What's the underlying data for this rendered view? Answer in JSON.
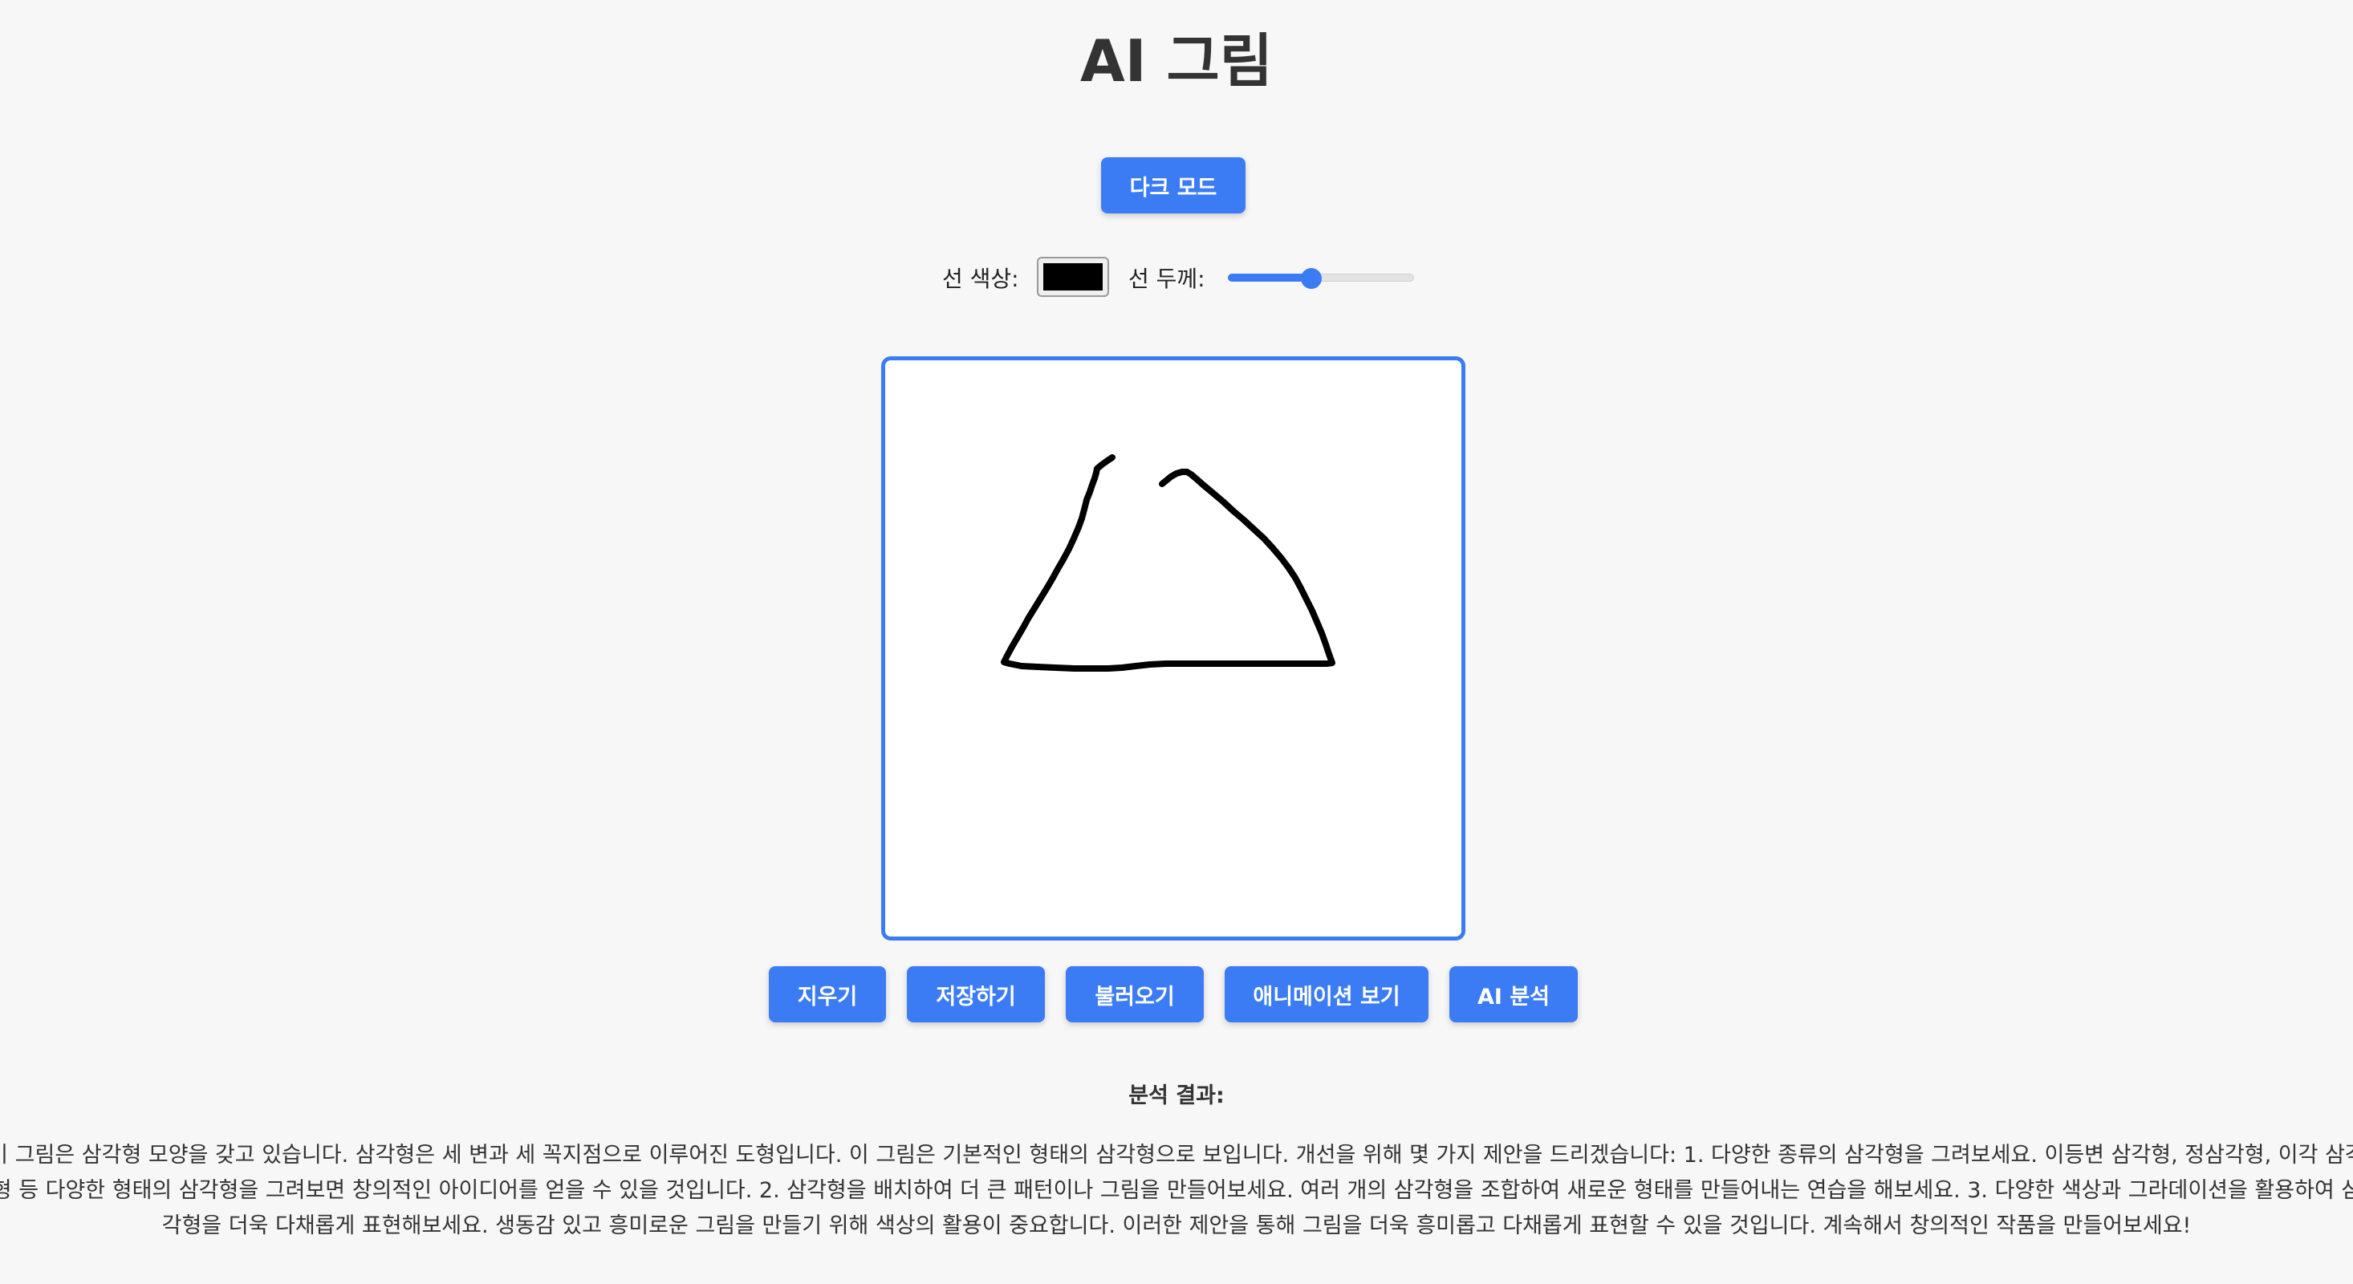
{
  "header": {
    "title": "AI 그림"
  },
  "toolbar": {
    "dark_mode_label": "다크 모드"
  },
  "controls": {
    "color_label": "선 색상:",
    "color_value": "#000000",
    "width_label": "선 두께:",
    "width_fraction": 0.45
  },
  "canvas": {
    "stroke_color": "#000000"
  },
  "actions": {
    "clear_label": "지우기",
    "save_label": "저장하기",
    "load_label": "불러오기",
    "animation_label": "애니메이션 보기",
    "ai_label": "AI 분석"
  },
  "result": {
    "heading": "분석 결과:",
    "text": "이 그림은 삼각형 모양을 갖고 있습니다. 삼각형은 세 변과 세 꼭지점으로 이루어진 도형입니다. 이 그림은 기본적인 형태의 삼각형으로 보입니다. 개선을 위해 몇 가지 제안을 드리겠습니다: 1. 다양한 종류의 삼각형을 그려보세요. 이등변 삼각형, 정삼각형, 이각 삼각형 등 다양한 형태의 삼각형을 그려보면 창의적인 아이디어를 얻을 수 있을 것입니다. 2. 삼각형을 배치하여 더 큰 패턴이나 그림을 만들어보세요. 여러 개의 삼각형을 조합하여 새로운 형태를 만들어내는 연습을 해보세요. 3. 다양한 색상과 그라데이션을 활용하여 삼각형을 더욱 다채롭게 표현해보세요. 생동감 있고 흥미로운 그림을 만들기 위해 색상의 활용이 중요합니다. 이러한 제안을 통해 그림을 더욱 흥미롭고 다채롭게 표현할 수 있을 것입니다. 계속해서 창의적인 작품을 만들어보세요!"
  },
  "colors": {
    "accent": "#3b7cf4",
    "background": "#f7f7f7",
    "canvas_background": "#ffffff"
  }
}
